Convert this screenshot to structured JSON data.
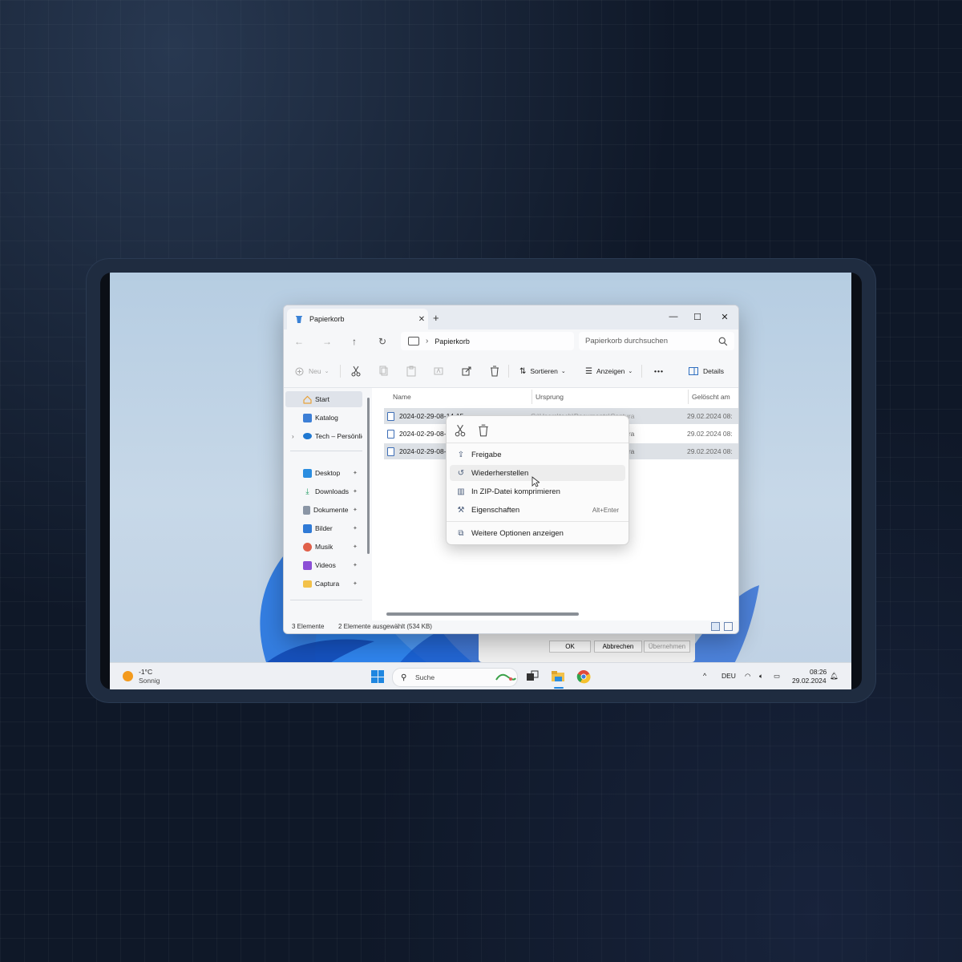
{
  "window": {
    "tab_title": "Papierkorb",
    "tab_close": "✕",
    "new_tab": "+",
    "controls": {
      "minimize": "—",
      "maximize": "☐",
      "close": "✕"
    }
  },
  "nav": {
    "back": "←",
    "forward": "→",
    "up": "↑",
    "refresh": "↻",
    "breadcrumb_sep": "›",
    "address": "Papierkorb",
    "search_placeholder": "Papierkorb durchsuchen"
  },
  "toolbar": {
    "new_label": "Neu",
    "sort_label": "Sortieren",
    "view_label": "Anzeigen",
    "more_label": "•••",
    "details_label": "Details"
  },
  "sidebar": {
    "items": [
      {
        "label": "Start",
        "icon": "home-icon",
        "color": "#e8a23a"
      },
      {
        "label": "Katalog",
        "icon": "gallery-icon",
        "color": "#3d7fd6"
      },
      {
        "label": "Tech – Persönlich",
        "icon": "onedrive-icon",
        "color": "#1f78d1"
      },
      {
        "label": "Desktop",
        "icon": "desktop-icon",
        "color": "#2b8de0"
      },
      {
        "label": "Downloads",
        "icon": "download-icon",
        "color": "#2aa06a"
      },
      {
        "label": "Dokumente",
        "icon": "document-icon",
        "color": "#8a95a5"
      },
      {
        "label": "Bilder",
        "icon": "pictures-icon",
        "color": "#2f7ad6"
      },
      {
        "label": "Musik",
        "icon": "music-icon",
        "color": "#e0604a"
      },
      {
        "label": "Videos",
        "icon": "videos-icon",
        "color": "#8b4fd6"
      },
      {
        "label": "Captura",
        "icon": "folder-icon",
        "color": "#f2c14a"
      }
    ],
    "expand_glyph": "›",
    "pin_glyph": "📌"
  },
  "columns": {
    "name": "Name",
    "origin": "Ursprung",
    "deleted": "Gelöscht am"
  },
  "rows": [
    {
      "name": "2024-02-29-08-14-15",
      "origin": "C:\\Users\\tech\\Documents\\Captura",
      "deleted": "29.02.2024 08:"
    },
    {
      "name": "2024-02-29-08-",
      "origin": "ptura",
      "deleted": "29.02.2024 08:"
    },
    {
      "name": "2024-02-29-08-",
      "origin": "ptura",
      "deleted": "29.02.2024 08:"
    }
  ],
  "status": {
    "count": "3 Elemente",
    "selection": "2 Elemente ausgewählt (534 KB)"
  },
  "context_menu": {
    "items": [
      {
        "label": "Freigabe",
        "icon": "share-icon",
        "shortcut": ""
      },
      {
        "label": "Wiederherstellen",
        "icon": "restore-icon",
        "shortcut": ""
      },
      {
        "label": "In ZIP-Datei komprimieren",
        "icon": "zip-icon",
        "shortcut": ""
      },
      {
        "label": "Eigenschaften",
        "icon": "properties-icon",
        "shortcut": "Alt+Enter"
      },
      {
        "label": "Weitere Optionen anzeigen",
        "icon": "more-options-icon",
        "shortcut": ""
      }
    ]
  },
  "dialog": {
    "ok": "OK",
    "cancel": "Abbrechen",
    "apply": "Übernehmen"
  },
  "taskbar": {
    "weather_temp": "-1°C",
    "weather_desc": "Sonnig",
    "search_placeholder": "Suche",
    "tray_up": "^",
    "language": "DEU",
    "time": "08:26",
    "date": "29.02.2024"
  },
  "colors": {
    "accent": "#1f86e0",
    "wallpaper": "#c7d8e8",
    "selection": "#dde1e6"
  }
}
